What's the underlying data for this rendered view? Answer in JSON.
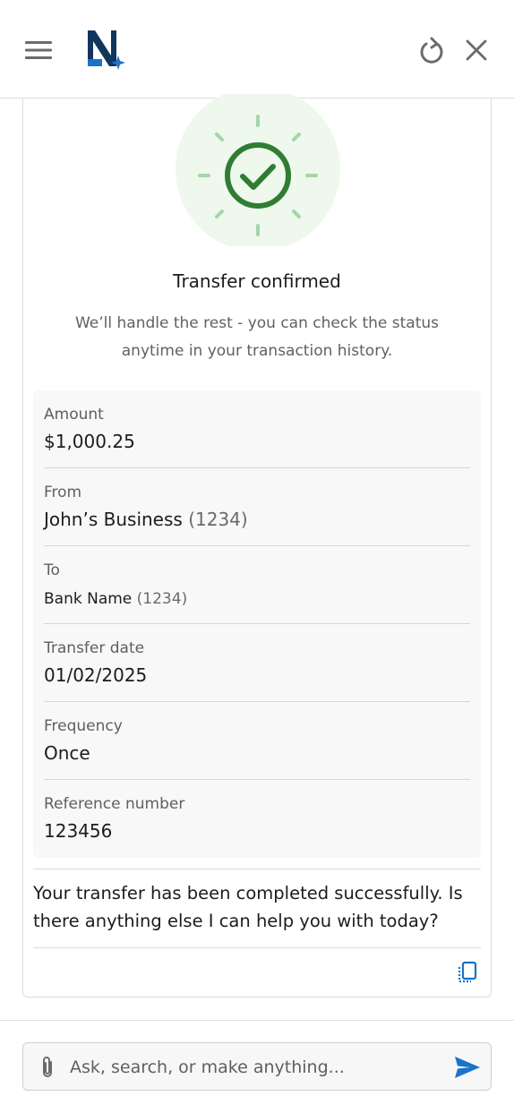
{
  "header": {
    "menu_icon": "hamburger-menu-icon",
    "logo_icon": "n-sparkle-logo",
    "refresh_icon": "refresh-icon",
    "close_icon": "close-icon"
  },
  "confirmation": {
    "status_icon": "check-circle-icon",
    "title": "Transfer confirmed",
    "subtitle": "We’ll handle the rest - you can check the status anytime in your transaction history."
  },
  "details": [
    {
      "label": "Amount",
      "value": "$1,000.25",
      "suffix": ""
    },
    {
      "label": "From",
      "value": "John’s Business",
      "suffix": "(1234)"
    },
    {
      "label": "To",
      "value": "Bank Name",
      "suffix": "(1234)"
    },
    {
      "label": "Transfer date",
      "value": "01/02/2025",
      "suffix": ""
    },
    {
      "label": "Frequency",
      "value": "Once",
      "suffix": ""
    },
    {
      "label": "Reference number",
      "value": "123456",
      "suffix": ""
    }
  ],
  "message": {
    "text": "Your transfer has been completed successfully. Is there anything else I can help you with today?",
    "copy_icon": "copy-icon"
  },
  "composer": {
    "placeholder": "Ask, search, or make anything...",
    "value": "",
    "attach_icon": "paperclip-icon",
    "send_icon": "send-icon"
  },
  "colors": {
    "success_green": "#2e7d32",
    "success_light": "#a5d6a7",
    "success_bg": "#eef8ec",
    "brand_navy": "#12355e",
    "accent_blue": "#1a73c8",
    "icon_gray": "#6b6b6b"
  }
}
